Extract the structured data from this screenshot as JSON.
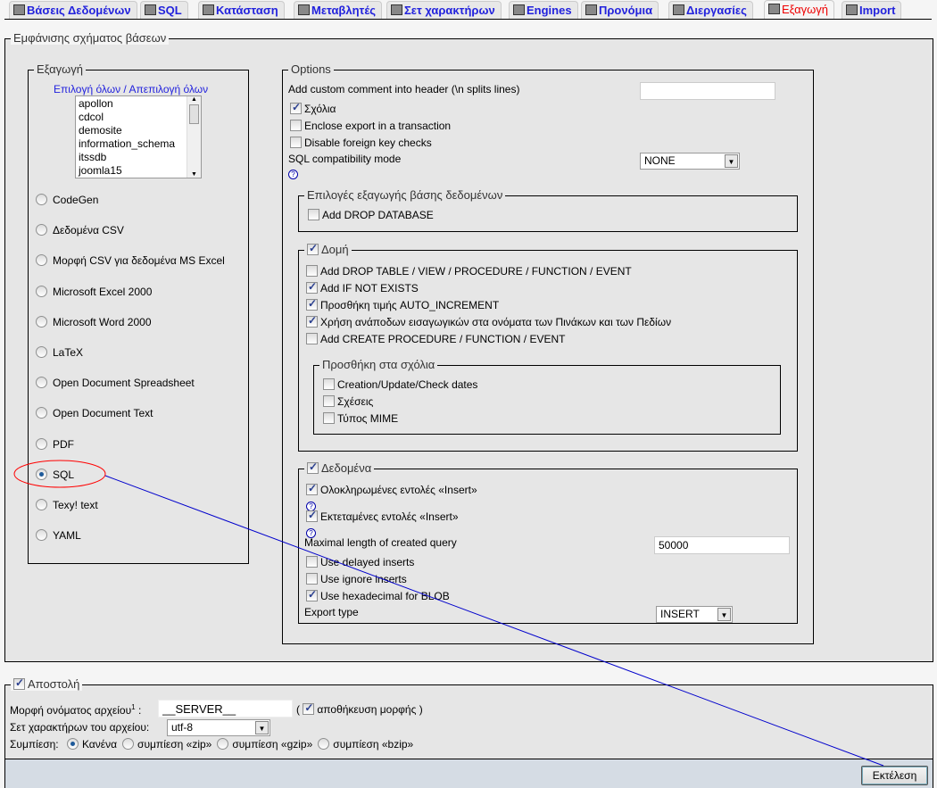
{
  "tabs": [
    {
      "label": "Βάσεις Δεδομένων",
      "icon": "databases-icon"
    },
    {
      "label": "SQL",
      "icon": "sql-icon"
    },
    {
      "label": "Κατάσταση",
      "icon": "traffic-light-icon"
    },
    {
      "label": "Μεταβλητές",
      "icon": "variables-icon"
    },
    {
      "label": "Σετ χαρακτήρων",
      "icon": "charset-icon"
    },
    {
      "label": "Engines",
      "icon": "engines-icon"
    },
    {
      "label": "Προνόμια",
      "icon": "privileges-icon"
    },
    {
      "label": "Διεργασίες",
      "icon": "processes-icon"
    },
    {
      "label": "Εξαγωγή",
      "icon": "export-icon",
      "active": true
    },
    {
      "label": "Import",
      "icon": "import-icon"
    }
  ],
  "main_legend": "Εμφάνισης σχήματος βάσεων",
  "export": {
    "legend": "Εξαγωγή",
    "select_all": "Επιλογή όλων",
    "separator": " / ",
    "deselect_all": "Απεπιλογή όλων",
    "databases": [
      "apollon",
      "cdcol",
      "demosite",
      "information_schema",
      "itssdb",
      "joomla15"
    ],
    "formats": [
      "CodeGen",
      "Δεδομένα CSV",
      "Μορφή CSV για δεδομένα MS Excel",
      "Microsoft Excel 2000",
      "Microsoft Word 2000",
      "LaTeX",
      "Open Document Spreadsheet",
      "Open Document Text",
      "PDF",
      "SQL",
      "Texy! text",
      "YAML"
    ],
    "selected_format": "SQL"
  },
  "options": {
    "legend": "Options",
    "comment_label": "Add custom comment into header (\\n splits lines)",
    "comment_value": "",
    "comments": "Σχόλια",
    "transaction": "Enclose export in a transaction",
    "fk_checks": "Disable foreign key checks",
    "compat_label": "SQL compatibility mode",
    "compat_value": "NONE",
    "db_legend": "Επιλογές εξαγωγής βάσης δεδομένων",
    "drop_db": "Add DROP DATABASE",
    "structure_legend": "Δομή",
    "structure_items": [
      {
        "label": "Add DROP TABLE / VIEW / PROCEDURE / FUNCTION / EVENT",
        "checked": false
      },
      {
        "label": "Add IF NOT EXISTS",
        "checked": true
      },
      {
        "label": "Προσθήκη τιμής AUTO_INCREMENT",
        "checked": true
      },
      {
        "label": "Χρήση ανάποδων εισαγωγικών στα ονόματα των Πινάκων και των Πεδίων",
        "checked": true
      },
      {
        "label": "Add CREATE PROCEDURE / FUNCTION / EVENT",
        "checked": false
      }
    ],
    "comments_legend": "Προσθήκη στα σχόλια",
    "comments_items": [
      "Creation/Update/Check dates",
      "Σχέσεις",
      "Τύπος MIME"
    ],
    "data_legend": "Δεδομένα",
    "complete_inserts": "Ολοκληρωμένες εντολές «Insert»",
    "extended_inserts": "Εκτεταμένες εντολές «Insert»",
    "max_len_label": "Maximal length of created query",
    "max_len_value": "50000",
    "delayed": "Use delayed inserts",
    "ignore": "Use ignore inserts",
    "hex": "Use hexadecimal for BLOB",
    "export_type_label": "Export type",
    "export_type_value": "INSERT"
  },
  "send": {
    "legend": "Αποστολή",
    "filename_label": "Μορφή ονόματος αρχείου",
    "filename_sup": "1",
    "filename_colon": " :",
    "filename_value": "__SERVER__",
    "paren_open": "(",
    "remember": "αποθήκευση μορφής",
    "paren_close": ")",
    "charset_label": "Σετ χαρακτήρων του αρχείου:",
    "charset_value": "utf-8",
    "compression_label": "Συμπίεση:",
    "compression": [
      "Κανένα",
      "συμπίεση «zip»",
      "συμπίεση «gzip»",
      "συμπίεση «bzip»"
    ]
  },
  "go_button": "Εκτέλεση",
  "colors": {
    "link": "#2222dd",
    "active_tab": "#ee0000",
    "annotation_ellipse": "#ff0000",
    "annotation_line": "#0000cc"
  }
}
